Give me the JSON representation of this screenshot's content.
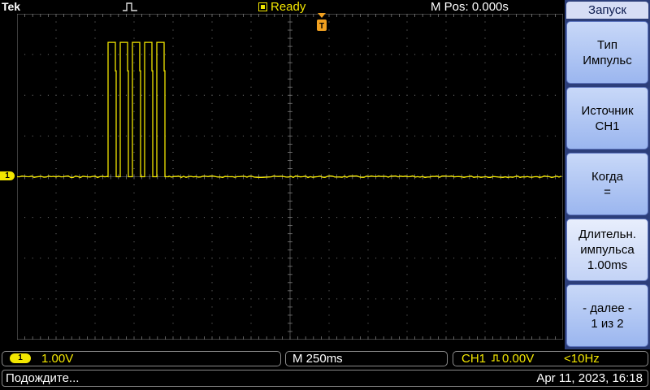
{
  "header": {
    "brand": "Tek",
    "status": "Ready",
    "m_pos": "M Pos: 0.000s"
  },
  "channel_marker": "1",
  "menu": {
    "title": "Запуск",
    "buttons": [
      {
        "line1": "Тип",
        "line2": "Импульс",
        "line3": ""
      },
      {
        "line1": "Источник",
        "line2": "CH1",
        "line3": ""
      },
      {
        "line1": "Когда",
        "line2": "=",
        "line3": ""
      },
      {
        "line1": "Длительн.",
        "line2": "импульса",
        "line3": "1.00ms"
      },
      {
        "line1": "- далее -",
        "line2": "1 из 2",
        "line3": ""
      }
    ]
  },
  "readouts": {
    "ch1_badge": "1",
    "ch1_scale": "1.00V",
    "time_scale": "M 250ms",
    "trig_source": "CH1",
    "trig_edge_icon": "pulse-icon",
    "trig_level": "0.00V",
    "trig_freq": "<10Hz"
  },
  "status_bar": {
    "message": "Подождите...",
    "datetime": "Apr 11, 2023, 16:18"
  },
  "colors": {
    "trace": "#f2e600",
    "grid": "#7a7a7a",
    "menu_bg": "#2c3e7a",
    "trigger_marker": "#f0a020"
  },
  "waveform": {
    "channel": "CH1",
    "baseline_divisions": 0,
    "pulse_high_divisions": 3.3,
    "pulse_count": 5
  }
}
